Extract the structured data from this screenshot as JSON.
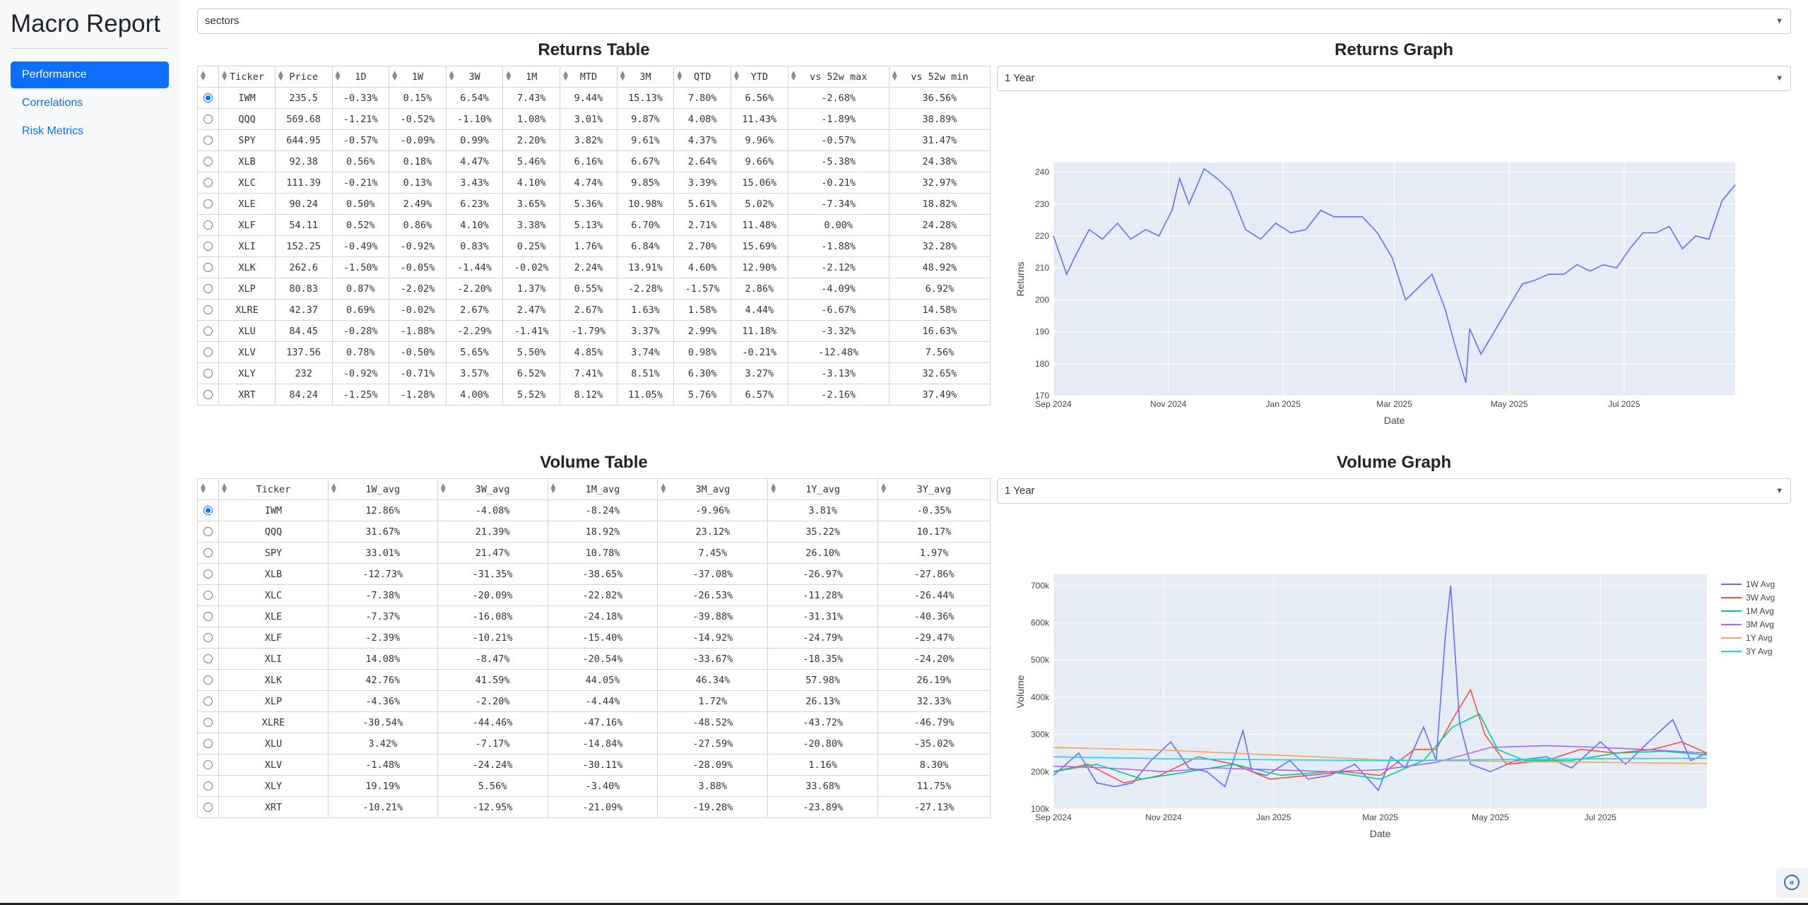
{
  "app": {
    "title": "Macro Report"
  },
  "nav": [
    {
      "label": "Performance",
      "active": true
    },
    {
      "label": "Correlations",
      "active": false
    },
    {
      "label": "Risk Metrics",
      "active": false
    }
  ],
  "universe_select": {
    "value": "sectors"
  },
  "returns_table": {
    "title": "Returns Table",
    "columns": [
      "Ticker",
      "Price",
      "1D",
      "1W",
      "3W",
      "1M",
      "MTD",
      "3M",
      "QTD",
      "YTD",
      "vs 52w max",
      "vs 52w min"
    ],
    "selected_index": 0,
    "rows": [
      [
        "IWM",
        "235.5",
        "-0.33%",
        "0.15%",
        "6.54%",
        "7.43%",
        "9.44%",
        "15.13%",
        "7.80%",
        "6.56%",
        "-2.68%",
        "36.56%"
      ],
      [
        "QQQ",
        "569.68",
        "-1.21%",
        "-0.52%",
        "-1.10%",
        "1.08%",
        "3.01%",
        "9.87%",
        "4.08%",
        "11.43%",
        "-1.89%",
        "38.89%"
      ],
      [
        "SPY",
        "644.95",
        "-0.57%",
        "-0.09%",
        "0.99%",
        "2.20%",
        "3.82%",
        "9.61%",
        "4.37%",
        "9.96%",
        "-0.57%",
        "31.47%"
      ],
      [
        "XLB",
        "92.38",
        "0.56%",
        "0.18%",
        "4.47%",
        "5.46%",
        "6.16%",
        "6.67%",
        "2.64%",
        "9.66%",
        "-5.38%",
        "24.38%"
      ],
      [
        "XLC",
        "111.39",
        "-0.21%",
        "0.13%",
        "3.43%",
        "4.10%",
        "4.74%",
        "9.85%",
        "3.39%",
        "15.06%",
        "-0.21%",
        "32.97%"
      ],
      [
        "XLE",
        "90.24",
        "0.50%",
        "2.49%",
        "6.23%",
        "3.65%",
        "5.36%",
        "10.98%",
        "5.61%",
        "5.02%",
        "-7.34%",
        "18.82%"
      ],
      [
        "XLF",
        "54.11",
        "0.52%",
        "0.86%",
        "4.10%",
        "3.38%",
        "5.13%",
        "6.70%",
        "2.71%",
        "11.48%",
        "0.00%",
        "24.28%"
      ],
      [
        "XLI",
        "152.25",
        "-0.49%",
        "-0.92%",
        "0.83%",
        "0.25%",
        "1.76%",
        "6.84%",
        "2.70%",
        "15.69%",
        "-1.88%",
        "32.28%"
      ],
      [
        "XLK",
        "262.6",
        "-1.50%",
        "-0.05%",
        "-1.44%",
        "-0.02%",
        "2.24%",
        "13.91%",
        "4.60%",
        "12.90%",
        "-2.12%",
        "48.92%"
      ],
      [
        "XLP",
        "80.83",
        "0.87%",
        "-2.02%",
        "-2.20%",
        "1.37%",
        "0.55%",
        "-2.28%",
        "-1.57%",
        "2.86%",
        "-4.09%",
        "6.92%"
      ],
      [
        "XLRE",
        "42.37",
        "0.69%",
        "-0.02%",
        "2.67%",
        "2.47%",
        "2.67%",
        "1.63%",
        "1.58%",
        "4.44%",
        "-6.67%",
        "14.58%"
      ],
      [
        "XLU",
        "84.45",
        "-0.28%",
        "-1.88%",
        "-2.29%",
        "-1.41%",
        "-1.79%",
        "3.37%",
        "2.99%",
        "11.18%",
        "-3.32%",
        "16.63%"
      ],
      [
        "XLV",
        "137.56",
        "0.78%",
        "-0.50%",
        "5.65%",
        "5.50%",
        "4.85%",
        "3.74%",
        "0.98%",
        "-0.21%",
        "-12.48%",
        "7.56%"
      ],
      [
        "XLY",
        "232",
        "-0.92%",
        "-0.71%",
        "3.57%",
        "6.52%",
        "7.41%",
        "8.51%",
        "6.30%",
        "3.27%",
        "-3.13%",
        "32.65%"
      ],
      [
        "XRT",
        "84.24",
        "-1.25%",
        "-1.28%",
        "4.00%",
        "5.52%",
        "8.12%",
        "11.05%",
        "5.76%",
        "6.57%",
        "-2.16%",
        "37.49%"
      ]
    ]
  },
  "volume_table": {
    "title": "Volume Table",
    "columns": [
      "Ticker",
      "1W_avg",
      "3W_avg",
      "1M_avg",
      "3M_avg",
      "1Y_avg",
      "3Y_avg"
    ],
    "selected_index": 0,
    "rows": [
      [
        "IWM",
        "12.86%",
        "-4.08%",
        "-8.24%",
        "-9.96%",
        "3.81%",
        "-0.35%"
      ],
      [
        "QQQ",
        "31.67%",
        "21.39%",
        "18.92%",
        "23.12%",
        "35.22%",
        "10.17%"
      ],
      [
        "SPY",
        "33.01%",
        "21.47%",
        "10.78%",
        "7.45%",
        "26.10%",
        "1.97%"
      ],
      [
        "XLB",
        "-12.73%",
        "-31.35%",
        "-38.65%",
        "-37.08%",
        "-26.97%",
        "-27.86%"
      ],
      [
        "XLC",
        "-7.38%",
        "-20.09%",
        "-22.82%",
        "-26.53%",
        "-11.28%",
        "-26.44%"
      ],
      [
        "XLE",
        "-7.37%",
        "-16.08%",
        "-24.18%",
        "-39.88%",
        "-31.31%",
        "-40.36%"
      ],
      [
        "XLF",
        "-2.39%",
        "-10.21%",
        "-15.40%",
        "-14.92%",
        "-24.79%",
        "-29.47%"
      ],
      [
        "XLI",
        "14.08%",
        "-8.47%",
        "-20.54%",
        "-33.67%",
        "-18.35%",
        "-24.20%"
      ],
      [
        "XLK",
        "42.76%",
        "41.59%",
        "44.05%",
        "46.34%",
        "57.98%",
        "26.19%"
      ],
      [
        "XLP",
        "-4.36%",
        "-2.20%",
        "-4.44%",
        "1.72%",
        "26.13%",
        "32.33%"
      ],
      [
        "XLRE",
        "-30.54%",
        "-44.46%",
        "-47.16%",
        "-48.52%",
        "-43.72%",
        "-46.79%"
      ],
      [
        "XLU",
        "3.42%",
        "-7.17%",
        "-14.84%",
        "-27.59%",
        "-20.80%",
        "-35.02%"
      ],
      [
        "XLV",
        "-1.48%",
        "-24.24%",
        "-30.11%",
        "-28.09%",
        "1.16%",
        "8.30%"
      ],
      [
        "XLY",
        "19.19%",
        "5.56%",
        "-3.40%",
        "3.88%",
        "33.68%",
        "11.75%"
      ],
      [
        "XRT",
        "-10.21%",
        "-12.95%",
        "-21.09%",
        "-19.28%",
        "-23.89%",
        "-27.13%"
      ]
    ]
  },
  "returns_graph": {
    "title": "Returns Graph",
    "period_select": "1 Year"
  },
  "volume_graph": {
    "title": "Volume Graph",
    "period_select": "1 Year"
  },
  "chart_data": [
    {
      "type": "line",
      "title": "",
      "xlabel": "Date",
      "ylabel": "Returns",
      "x_ticks": [
        "Sep 2024",
        "Nov 2024",
        "Jan 2025",
        "Mar 2025",
        "May 2025",
        "Jul 2025"
      ],
      "y_ticks": [
        170,
        180,
        190,
        200,
        210,
        220,
        230,
        240
      ],
      "ylim": [
        170,
        243
      ],
      "xlim": [
        "2024-09-01",
        "2025-08-29"
      ],
      "grid": true,
      "series": [
        {
          "color": "#636efa",
          "x": [
            "2024-09-01",
            "2024-09-08",
            "2024-09-12",
            "2024-09-20",
            "2024-09-27",
            "2024-10-05",
            "2024-10-12",
            "2024-10-20",
            "2024-10-27",
            "2024-11-03",
            "2024-11-07",
            "2024-11-12",
            "2024-11-20",
            "2024-11-27",
            "2024-12-04",
            "2024-12-12",
            "2024-12-20",
            "2024-12-28",
            "2025-01-05",
            "2025-01-13",
            "2025-01-21",
            "2025-01-28",
            "2025-02-05",
            "2025-02-12",
            "2025-02-20",
            "2025-02-28",
            "2025-03-07",
            "2025-03-14",
            "2025-03-21",
            "2025-03-28",
            "2025-04-03",
            "2025-04-08",
            "2025-04-10",
            "2025-04-16",
            "2025-04-24",
            "2025-05-01",
            "2025-05-08",
            "2025-05-14",
            "2025-05-22",
            "2025-05-30",
            "2025-06-06",
            "2025-06-13",
            "2025-06-20",
            "2025-06-27",
            "2025-07-04",
            "2025-07-11",
            "2025-07-18",
            "2025-07-25",
            "2025-08-01",
            "2025-08-08",
            "2025-08-15",
            "2025-08-22",
            "2025-08-29"
          ],
          "y": [
            220,
            208,
            213,
            222,
            219,
            224,
            219,
            222,
            220,
            228,
            238,
            230,
            241,
            238,
            234,
            222,
            219,
            224,
            221,
            222,
            228,
            226,
            226,
            226,
            221,
            213,
            200,
            204,
            208,
            197,
            184,
            174,
            191,
            183,
            191,
            198,
            205,
            206,
            208,
            208,
            211,
            209,
            211,
            210,
            216,
            221,
            221,
            223,
            216,
            220,
            219,
            231,
            236
          ]
        }
      ]
    },
    {
      "type": "line",
      "title": "",
      "xlabel": "Date",
      "ylabel": "Volume",
      "x_ticks": [
        "Sep 2024",
        "Nov 2024",
        "Jan 2025",
        "Mar 2025",
        "May 2025",
        "Jul 2025"
      ],
      "y_ticks": [
        "100k",
        "200k",
        "300k",
        "400k",
        "500k",
        "600k",
        "700k"
      ],
      "ylim": [
        100000,
        730000
      ],
      "xlim": [
        "2024-09-01",
        "2025-08-29"
      ],
      "grid": true,
      "legend": "top-right",
      "series": [
        {
          "name": "1W Avg",
          "color": "#636efa",
          "x": [
            "2024-09-01",
            "2024-09-15",
            "2024-09-25",
            "2024-10-05",
            "2024-10-15",
            "2024-10-25",
            "2024-11-05",
            "2024-11-15",
            "2024-11-25",
            "2024-12-05",
            "2024-12-15",
            "2024-12-20",
            "2024-12-28",
            "2025-01-10",
            "2025-01-20",
            "2025-02-01",
            "2025-02-15",
            "2025-02-28",
            "2025-03-07",
            "2025-03-15",
            "2025-03-25",
            "2025-04-01",
            "2025-04-06",
            "2025-04-09",
            "2025-04-14",
            "2025-04-20",
            "2025-05-01",
            "2025-05-15",
            "2025-06-01",
            "2025-06-15",
            "2025-07-01",
            "2025-07-15",
            "2025-08-01",
            "2025-08-10",
            "2025-08-20",
            "2025-08-29"
          ],
          "y": [
            190000,
            250000,
            170000,
            160000,
            170000,
            230000,
            280000,
            210000,
            200000,
            160000,
            310000,
            200000,
            190000,
            230000,
            180000,
            190000,
            220000,
            150000,
            240000,
            210000,
            320000,
            230000,
            560000,
            700000,
            330000,
            220000,
            200000,
            230000,
            240000,
            210000,
            280000,
            220000,
            300000,
            340000,
            230000,
            250000
          ]
        },
        {
          "name": "3W Avg",
          "color": "#ef553b",
          "x": [
            "2024-09-01",
            "2024-09-20",
            "2024-10-10",
            "2024-10-30",
            "2024-11-20",
            "2024-12-10",
            "2024-12-30",
            "2025-01-20",
            "2025-02-10",
            "2025-03-01",
            "2025-03-20",
            "2025-04-01",
            "2025-04-10",
            "2025-04-20",
            "2025-04-28",
            "2025-05-10",
            "2025-06-01",
            "2025-06-20",
            "2025-07-10",
            "2025-07-30",
            "2025-08-15",
            "2025-08-29"
          ],
          "y": [
            200000,
            220000,
            170000,
            190000,
            240000,
            220000,
            180000,
            190000,
            200000,
            190000,
            260000,
            260000,
            340000,
            420000,
            300000,
            220000,
            230000,
            260000,
            250000,
            260000,
            280000,
            250000
          ]
        },
        {
          "name": "1M Avg",
          "color": "#00cc96",
          "x": [
            "2024-09-01",
            "2024-09-25",
            "2024-10-20",
            "2024-11-15",
            "2024-12-10",
            "2025-01-05",
            "2025-02-01",
            "2025-03-01",
            "2025-03-25",
            "2025-04-10",
            "2025-04-25",
            "2025-05-05",
            "2025-05-20",
            "2025-06-15",
            "2025-07-10",
            "2025-08-05",
            "2025-08-29"
          ],
          "y": [
            200000,
            220000,
            180000,
            200000,
            220000,
            190000,
            200000,
            180000,
            230000,
            320000,
            355000,
            260000,
            230000,
            230000,
            250000,
            255000,
            245000
          ]
        },
        {
          "name": "3M Avg",
          "color": "#ab63fa",
          "x": [
            "2024-09-01",
            "2024-10-01",
            "2024-11-01",
            "2024-12-01",
            "2025-01-01",
            "2025-02-01",
            "2025-03-01",
            "2025-04-01",
            "2025-05-01",
            "2025-06-01",
            "2025-07-01",
            "2025-08-01",
            "2025-08-29"
          ],
          "y": [
            215000,
            210000,
            200000,
            210000,
            205000,
            200000,
            205000,
            225000,
            265000,
            270000,
            265000,
            258000,
            250000
          ]
        },
        {
          "name": "1Y Avg",
          "color": "#ffa15a",
          "x": [
            "2024-09-01",
            "2024-11-01",
            "2025-01-01",
            "2025-03-01",
            "2025-05-01",
            "2025-07-01",
            "2025-08-29"
          ],
          "y": [
            265000,
            258000,
            245000,
            232000,
            228000,
            225000,
            222000
          ]
        },
        {
          "name": "3Y Avg",
          "color": "#19d3f3",
          "x": [
            "2024-09-01",
            "2024-11-01",
            "2025-01-01",
            "2025-03-01",
            "2025-05-01",
            "2025-07-01",
            "2025-08-29"
          ],
          "y": [
            240000,
            235000,
            232000,
            230000,
            232000,
            235000,
            236000
          ]
        }
      ]
    }
  ]
}
